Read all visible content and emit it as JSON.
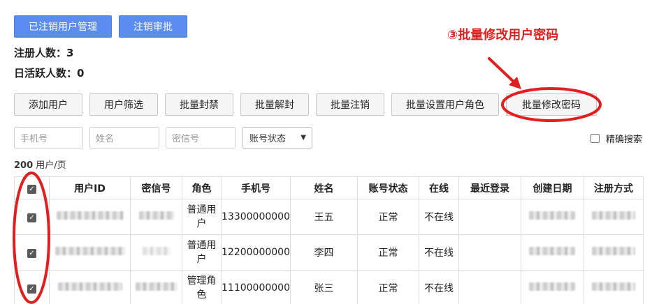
{
  "top_buttons": {
    "cancelled_users": "已注销用户管理",
    "cancel_approval": "注销审批"
  },
  "stats": {
    "registered": "注册人数：3",
    "daily_active": "日活跃人数：0"
  },
  "toolbar": {
    "add_user": "添加用户",
    "filter_users": "用户筛选",
    "batch_ban": "批量封禁",
    "batch_unban": "批量解封",
    "batch_cancel": "批量注销",
    "batch_set_role": "批量设置用户角色",
    "batch_change_password": "批量修改密码"
  },
  "filters": {
    "phone_placeholder": "手机号",
    "name_placeholder": "姓名",
    "key_placeholder": "密信号",
    "status_select": "账号状态",
    "exact_search": "精确搜索"
  },
  "per_page": {
    "count": "200",
    "unit": "用户/页"
  },
  "table": {
    "headers": [
      "用户ID",
      "密信号",
      "角色",
      "手机号",
      "姓名",
      "账号状态",
      "在线",
      "最近登录",
      "创建日期",
      "注册方式"
    ],
    "rows": [
      {
        "role": "普通用户",
        "phone": "13300000000",
        "name": "王五",
        "status": "正常",
        "online": "不在线"
      },
      {
        "role": "普通用户",
        "phone": "12200000000",
        "name": "李四",
        "status": "正常",
        "online": "不在线"
      },
      {
        "role": "管理角色",
        "phone": "11100000000",
        "name": "张三",
        "status": "正常",
        "online": "不在线"
      }
    ]
  },
  "annotation": {
    "text": "③批量修改用户密码",
    "color": "#e02020"
  }
}
